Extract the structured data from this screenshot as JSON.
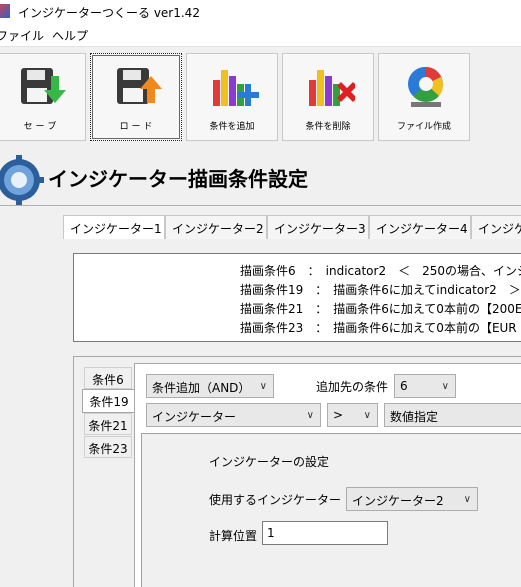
{
  "window": {
    "title": "インジケーターつくーる ver1.42"
  },
  "menu": {
    "items": [
      "ファイル",
      "ヘルプ"
    ]
  },
  "toolbar": {
    "save": "セ ー ブ",
    "load": "ロ ー ド",
    "add": "条件を追加",
    "delete": "条件を削除",
    "create": "ファイル作成"
  },
  "header": {
    "title": "インジケーター描画条件設定"
  },
  "indicator_tabs": [
    "インジケーター1",
    "インジケーター2",
    "インジケーター3",
    "インジケーター4",
    "インジケ"
  ],
  "summary_lines": [
    "描画条件6　：　indicator2　＜　250の場合、インジ",
    "描画条件19　：　描画条件6に加えてindicator2　＞",
    "描画条件21　：　描画条件6に加えて0本前の【200E",
    "描画条件23　：　描画条件6に加えて0本前の【EUR"
  ],
  "condition_tabs": [
    "条件6",
    "条件19",
    "条件21",
    "条件23"
  ],
  "selected_condition": "条件19",
  "condition_form": {
    "add_mode": "条件追加（AND）",
    "target_label": "追加先の条件",
    "target_value": "6",
    "operand_left": "インジケーター",
    "operator": ">",
    "operand_right": "数値指定"
  },
  "indicator_settings": {
    "title": "インジケーターの設定",
    "use_label": "使用するインジケーター",
    "use_value": "インジケーター2",
    "calc_label": "計算位置",
    "calc_value": "1"
  }
}
